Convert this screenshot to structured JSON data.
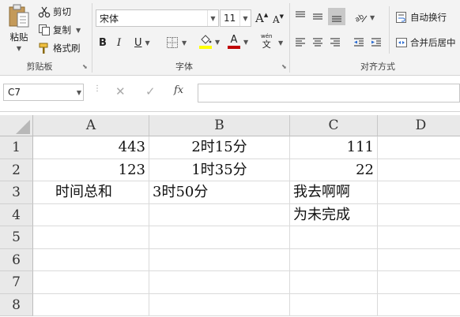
{
  "ribbon": {
    "clipboard": {
      "paste_label": "粘贴",
      "cut_label": "剪切",
      "copy_label": "复制",
      "format_painter_label": "格式刷",
      "group_label": "剪贴板"
    },
    "font": {
      "font_name": "宋体",
      "font_size": "11",
      "grow_label": "A",
      "shrink_label": "A",
      "bold_label": "B",
      "italic_label": "I",
      "underline_label": "U",
      "highlight_letter": "ab",
      "font_color_letter": "A",
      "phonetic_top": "wén",
      "phonetic_bottom": "文",
      "group_label": "字体",
      "font_color": "#c00000",
      "highlight_color": "#ffff00"
    },
    "alignment": {
      "wrap_text_label": "自动换行",
      "merge_center_label": "合并后居中",
      "group_label": "对齐方式"
    }
  },
  "formula_bar": {
    "name_box": "C7",
    "fx_label": "fx",
    "formula": ""
  },
  "sheet": {
    "columns": [
      "A",
      "B",
      "C",
      "D"
    ],
    "rows": [
      "1",
      "2",
      "3",
      "4",
      "5",
      "6",
      "7",
      "8"
    ],
    "cells": {
      "A1": "443",
      "B1": "2时15分",
      "C1": "111",
      "A2": "123",
      "B2": "1时35分",
      "C2": "22",
      "A3": "时间总和",
      "B3": "3时50分",
      "C3": "我去啊啊",
      "C4": "为未完成"
    }
  }
}
